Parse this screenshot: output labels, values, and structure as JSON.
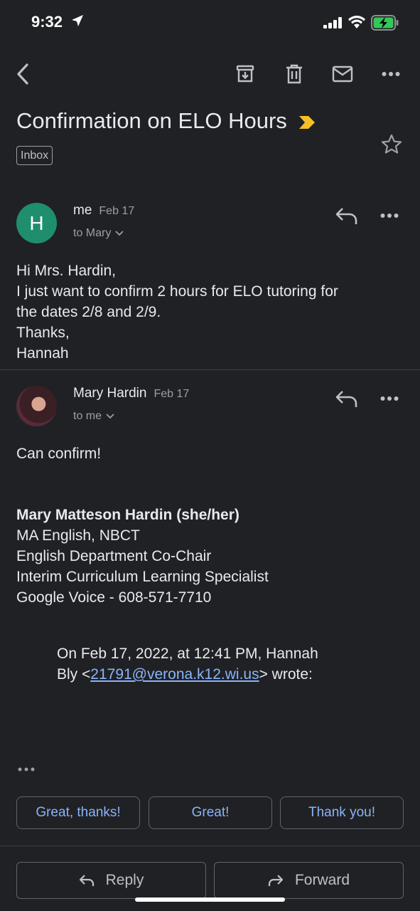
{
  "status_bar": {
    "time": "9:32"
  },
  "toolbar": {
    "back_icon": "chevron-left-icon",
    "archive_icon": "archive-icon",
    "delete_icon": "trash-icon",
    "mark_unread_icon": "mail-icon",
    "more_icon": "more-horizontal-icon"
  },
  "subject": "Confirmation on ELO Hours",
  "label": "Inbox",
  "colors": {
    "background": "#202124",
    "accent": "#8ab4f8",
    "importance": "#f6bf26",
    "avatar_h": "#1e8e6e"
  },
  "messages": [
    {
      "avatar_initial": "H",
      "sender": "me",
      "date": "Feb 17",
      "to": "to Mary",
      "body": [
        "Hi Mrs. Hardin,",
        "I just want to confirm 2 hours for ELO tutoring for",
        "the dates 2/8 and 2/9.",
        "Thanks,",
        "Hannah"
      ]
    },
    {
      "sender": "Mary Hardin",
      "date": "Feb 17",
      "to": "to me",
      "body": [
        "Can confirm!"
      ],
      "signature": {
        "name": "Mary Matteson Hardin (she/her)",
        "lines": [
          "MA English, NBCT",
          "English Department Co-Chair",
          "Interim Curriculum Learning Specialist",
          "Google Voice - 608-571-7710"
        ]
      },
      "quote": {
        "line1": "On Feb 17, 2022, at 12:41 PM, Hannah",
        "line2_prefix": "Bly <",
        "email": "21791@verona.k12.wi.us",
        "line2_suffix": "> wrote:"
      }
    }
  ],
  "smart_replies": [
    "Great, thanks!",
    "Great!",
    "Thank you!"
  ],
  "actions": {
    "reply": "Reply",
    "forward": "Forward"
  }
}
